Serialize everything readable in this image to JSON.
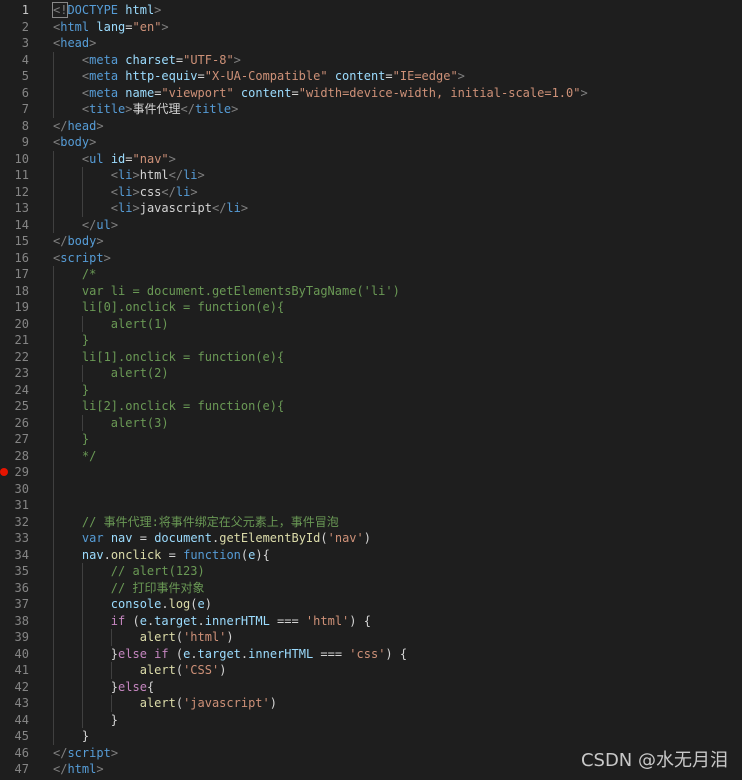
{
  "editor": {
    "theme": {
      "background": "#1e1e1e",
      "breakpoint_color": "#e51400"
    },
    "active_line": 1,
    "breakpoint_line": 29,
    "lines": [
      {
        "n": "1",
        "tokens": [
          [
            "punc",
            "<!"
          ],
          [
            "tag",
            "DOCTYPE"
          ],
          [
            "plain",
            " "
          ],
          [
            "attr",
            "html"
          ],
          [
            "punc",
            ">"
          ]
        ]
      },
      {
        "n": "2",
        "tokens": [
          [
            "punc",
            "<"
          ],
          [
            "tag",
            "html"
          ],
          [
            "plain",
            " "
          ],
          [
            "attr",
            "lang"
          ],
          [
            "plain",
            "="
          ],
          [
            "str",
            "\"en\""
          ],
          [
            "punc",
            ">"
          ]
        ]
      },
      {
        "n": "3",
        "tokens": [
          [
            "punc",
            "<"
          ],
          [
            "tag",
            "head"
          ],
          [
            "punc",
            ">"
          ]
        ]
      },
      {
        "n": "4",
        "tokens": [
          [
            "plain",
            "    "
          ],
          [
            "punc",
            "<"
          ],
          [
            "tag",
            "meta"
          ],
          [
            "plain",
            " "
          ],
          [
            "attr",
            "charset"
          ],
          [
            "plain",
            "="
          ],
          [
            "str",
            "\"UTF-8\""
          ],
          [
            "punc",
            ">"
          ]
        ]
      },
      {
        "n": "5",
        "tokens": [
          [
            "plain",
            "    "
          ],
          [
            "punc",
            "<"
          ],
          [
            "tag",
            "meta"
          ],
          [
            "plain",
            " "
          ],
          [
            "attr",
            "http-equiv"
          ],
          [
            "plain",
            "="
          ],
          [
            "str",
            "\"X-UA-Compatible\""
          ],
          [
            "plain",
            " "
          ],
          [
            "attr",
            "content"
          ],
          [
            "plain",
            "="
          ],
          [
            "str",
            "\"IE=edge\""
          ],
          [
            "punc",
            ">"
          ]
        ]
      },
      {
        "n": "6",
        "tokens": [
          [
            "plain",
            "    "
          ],
          [
            "punc",
            "<"
          ],
          [
            "tag",
            "meta"
          ],
          [
            "plain",
            " "
          ],
          [
            "attr",
            "name"
          ],
          [
            "plain",
            "="
          ],
          [
            "str",
            "\"viewport\""
          ],
          [
            "plain",
            " "
          ],
          [
            "attr",
            "content"
          ],
          [
            "plain",
            "="
          ],
          [
            "str",
            "\"width=device-width, initial-scale=1.0\""
          ],
          [
            "punc",
            ">"
          ]
        ]
      },
      {
        "n": "7",
        "tokens": [
          [
            "plain",
            "    "
          ],
          [
            "punc",
            "<"
          ],
          [
            "tag",
            "title"
          ],
          [
            "punc",
            ">"
          ],
          [
            "text",
            "事件代理"
          ],
          [
            "punc",
            "</"
          ],
          [
            "tag",
            "title"
          ],
          [
            "punc",
            ">"
          ]
        ]
      },
      {
        "n": "8",
        "tokens": [
          [
            "punc",
            "</"
          ],
          [
            "tag",
            "head"
          ],
          [
            "punc",
            ">"
          ]
        ]
      },
      {
        "n": "9",
        "tokens": [
          [
            "punc",
            "<"
          ],
          [
            "tag",
            "body"
          ],
          [
            "punc",
            ">"
          ]
        ]
      },
      {
        "n": "10",
        "tokens": [
          [
            "plain",
            "    "
          ],
          [
            "punc",
            "<"
          ],
          [
            "tag",
            "ul"
          ],
          [
            "plain",
            " "
          ],
          [
            "attr",
            "id"
          ],
          [
            "plain",
            "="
          ],
          [
            "str",
            "\"nav\""
          ],
          [
            "punc",
            ">"
          ]
        ]
      },
      {
        "n": "11",
        "tokens": [
          [
            "plain",
            "        "
          ],
          [
            "punc",
            "<"
          ],
          [
            "tag",
            "li"
          ],
          [
            "punc",
            ">"
          ],
          [
            "text",
            "html"
          ],
          [
            "punc",
            "</"
          ],
          [
            "tag",
            "li"
          ],
          [
            "punc",
            ">"
          ]
        ]
      },
      {
        "n": "12",
        "tokens": [
          [
            "plain",
            "        "
          ],
          [
            "punc",
            "<"
          ],
          [
            "tag",
            "li"
          ],
          [
            "punc",
            ">"
          ],
          [
            "text",
            "css"
          ],
          [
            "punc",
            "</"
          ],
          [
            "tag",
            "li"
          ],
          [
            "punc",
            ">"
          ]
        ]
      },
      {
        "n": "13",
        "tokens": [
          [
            "plain",
            "        "
          ],
          [
            "punc",
            "<"
          ],
          [
            "tag",
            "li"
          ],
          [
            "punc",
            ">"
          ],
          [
            "text",
            "javascript"
          ],
          [
            "punc",
            "</"
          ],
          [
            "tag",
            "li"
          ],
          [
            "punc",
            ">"
          ]
        ]
      },
      {
        "n": "14",
        "tokens": [
          [
            "plain",
            "    "
          ],
          [
            "punc",
            "</"
          ],
          [
            "tag",
            "ul"
          ],
          [
            "punc",
            ">"
          ]
        ]
      },
      {
        "n": "15",
        "tokens": [
          [
            "punc",
            "</"
          ],
          [
            "tag",
            "body"
          ],
          [
            "punc",
            ">"
          ]
        ]
      },
      {
        "n": "16",
        "tokens": [
          [
            "punc",
            "<"
          ],
          [
            "tag",
            "script"
          ],
          [
            "punc",
            ">"
          ]
        ]
      },
      {
        "n": "17",
        "tokens": [
          [
            "plain",
            "    "
          ],
          [
            "comment",
            "/*"
          ]
        ]
      },
      {
        "n": "18",
        "tokens": [
          [
            "plain",
            "    "
          ],
          [
            "comment",
            "var li = document.getElementsByTagName('li')"
          ]
        ]
      },
      {
        "n": "19",
        "tokens": [
          [
            "plain",
            "    "
          ],
          [
            "comment",
            "li[0].onclick = function(e){"
          ]
        ]
      },
      {
        "n": "20",
        "tokens": [
          [
            "plain",
            "        "
          ],
          [
            "comment",
            "alert(1)"
          ]
        ]
      },
      {
        "n": "21",
        "tokens": [
          [
            "plain",
            "    "
          ],
          [
            "comment",
            "}"
          ]
        ]
      },
      {
        "n": "22",
        "tokens": [
          [
            "plain",
            "    "
          ],
          [
            "comment",
            "li[1].onclick = function(e){"
          ]
        ]
      },
      {
        "n": "23",
        "tokens": [
          [
            "plain",
            "        "
          ],
          [
            "comment",
            "alert(2)"
          ]
        ]
      },
      {
        "n": "24",
        "tokens": [
          [
            "plain",
            "    "
          ],
          [
            "comment",
            "}"
          ]
        ]
      },
      {
        "n": "25",
        "tokens": [
          [
            "plain",
            "    "
          ],
          [
            "comment",
            "li[2].onclick = function(e){"
          ]
        ]
      },
      {
        "n": "26",
        "tokens": [
          [
            "plain",
            "        "
          ],
          [
            "comment",
            "alert(3)"
          ]
        ]
      },
      {
        "n": "27",
        "tokens": [
          [
            "plain",
            "    "
          ],
          [
            "comment",
            "}"
          ]
        ]
      },
      {
        "n": "28",
        "tokens": [
          [
            "plain",
            "    "
          ],
          [
            "comment",
            "*/"
          ]
        ]
      },
      {
        "n": "29",
        "tokens": []
      },
      {
        "n": "30",
        "tokens": []
      },
      {
        "n": "31",
        "tokens": []
      },
      {
        "n": "32",
        "tokens": [
          [
            "plain",
            "    "
          ],
          [
            "comment",
            "// 事件代理:将事件绑定在父元素上，事件冒泡"
          ]
        ]
      },
      {
        "n": "33",
        "tokens": [
          [
            "plain",
            "    "
          ],
          [
            "kw",
            "var"
          ],
          [
            "plain",
            " "
          ],
          [
            "var",
            "nav"
          ],
          [
            "plain",
            " = "
          ],
          [
            "var",
            "document"
          ],
          [
            "plain",
            "."
          ],
          [
            "fn",
            "getElementById"
          ],
          [
            "plain",
            "("
          ],
          [
            "str",
            "'nav'"
          ],
          [
            "plain",
            ")"
          ]
        ]
      },
      {
        "n": "34",
        "tokens": [
          [
            "plain",
            "    "
          ],
          [
            "var",
            "nav"
          ],
          [
            "plain",
            "."
          ],
          [
            "fn",
            "onclick"
          ],
          [
            "plain",
            " = "
          ],
          [
            "kw",
            "function"
          ],
          [
            "plain",
            "("
          ],
          [
            "var",
            "e"
          ],
          [
            "plain",
            "){"
          ]
        ]
      },
      {
        "n": "35",
        "tokens": [
          [
            "plain",
            "        "
          ],
          [
            "comment",
            "// alert(123)"
          ]
        ]
      },
      {
        "n": "36",
        "tokens": [
          [
            "plain",
            "        "
          ],
          [
            "comment",
            "// 打印事件对象"
          ]
        ]
      },
      {
        "n": "37",
        "tokens": [
          [
            "plain",
            "        "
          ],
          [
            "var",
            "console"
          ],
          [
            "plain",
            "."
          ],
          [
            "fn",
            "log"
          ],
          [
            "plain",
            "("
          ],
          [
            "var",
            "e"
          ],
          [
            "plain",
            ")"
          ]
        ]
      },
      {
        "n": "38",
        "tokens": [
          [
            "plain",
            "        "
          ],
          [
            "ctrl",
            "if"
          ],
          [
            "plain",
            " ("
          ],
          [
            "var",
            "e"
          ],
          [
            "plain",
            "."
          ],
          [
            "var",
            "target"
          ],
          [
            "plain",
            "."
          ],
          [
            "var",
            "innerHTML"
          ],
          [
            "plain",
            " === "
          ],
          [
            "str",
            "'html'"
          ],
          [
            "plain",
            ") {"
          ]
        ]
      },
      {
        "n": "39",
        "tokens": [
          [
            "plain",
            "            "
          ],
          [
            "fn",
            "alert"
          ],
          [
            "plain",
            "("
          ],
          [
            "str",
            "'html'"
          ],
          [
            "plain",
            ")"
          ]
        ]
      },
      {
        "n": "40",
        "tokens": [
          [
            "plain",
            "        }"
          ],
          [
            "ctrl",
            "else"
          ],
          [
            "plain",
            " "
          ],
          [
            "ctrl",
            "if"
          ],
          [
            "plain",
            " ("
          ],
          [
            "var",
            "e"
          ],
          [
            "plain",
            "."
          ],
          [
            "var",
            "target"
          ],
          [
            "plain",
            "."
          ],
          [
            "var",
            "innerHTML"
          ],
          [
            "plain",
            " === "
          ],
          [
            "str",
            "'css'"
          ],
          [
            "plain",
            ") {"
          ]
        ]
      },
      {
        "n": "41",
        "tokens": [
          [
            "plain",
            "            "
          ],
          [
            "fn",
            "alert"
          ],
          [
            "plain",
            "("
          ],
          [
            "str",
            "'CSS'"
          ],
          [
            "plain",
            ")"
          ]
        ]
      },
      {
        "n": "42",
        "tokens": [
          [
            "plain",
            "        }"
          ],
          [
            "ctrl",
            "else"
          ],
          [
            "plain",
            "{"
          ]
        ]
      },
      {
        "n": "43",
        "tokens": [
          [
            "plain",
            "            "
          ],
          [
            "fn",
            "alert"
          ],
          [
            "plain",
            "("
          ],
          [
            "str",
            "'javascript'"
          ],
          [
            "plain",
            ")"
          ]
        ]
      },
      {
        "n": "44",
        "tokens": [
          [
            "plain",
            "        }"
          ]
        ]
      },
      {
        "n": "45",
        "tokens": [
          [
            "plain",
            "    }"
          ]
        ]
      },
      {
        "n": "46",
        "tokens": [
          [
            "punc",
            "</"
          ],
          [
            "tag",
            "script"
          ],
          [
            "punc",
            ">"
          ]
        ]
      },
      {
        "n": "47",
        "tokens": [
          [
            "punc",
            "</"
          ],
          [
            "tag",
            "html"
          ],
          [
            "punc",
            ">"
          ]
        ]
      }
    ]
  },
  "watermark": "CSDN @水无月泪"
}
